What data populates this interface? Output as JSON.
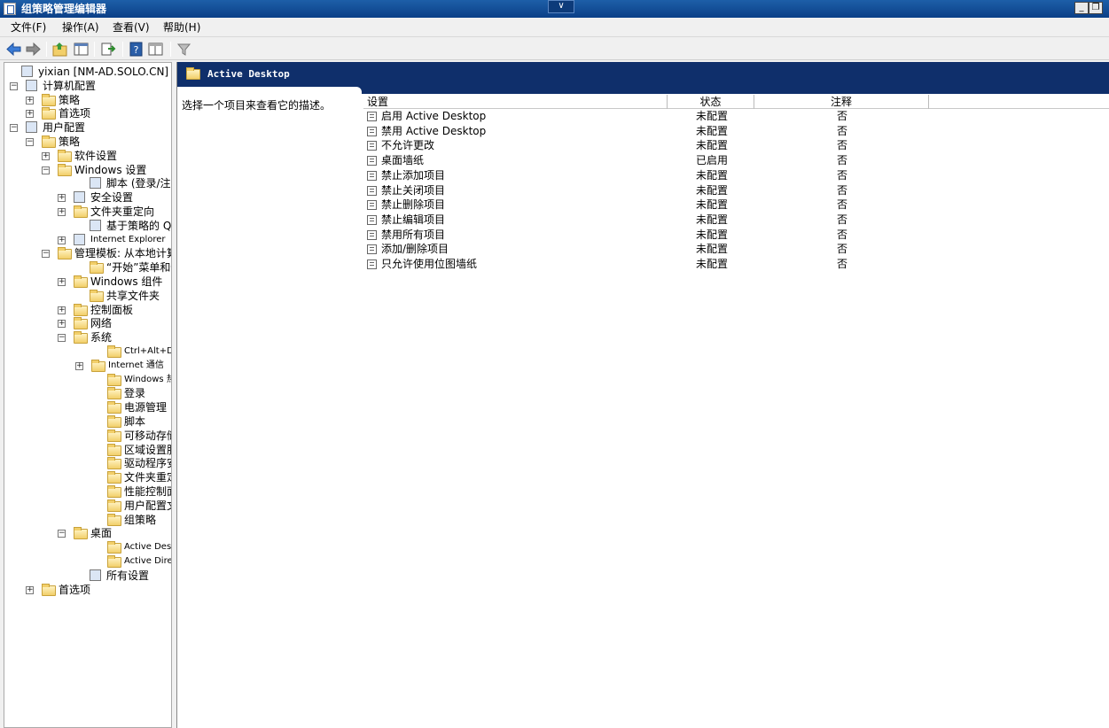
{
  "window": {
    "title": "组策略管理编辑器",
    "collapse_glyph": "∨",
    "minimize_glyph": "_",
    "maximize_glyph": "❐"
  },
  "menu": [
    "文件(F)",
    "操作(A)",
    "查看(V)",
    "帮助(H)"
  ],
  "tree": [
    {
      "label": "yixian [NM-AD.SOLO.CN] 策略",
      "icon": "policy-doc-icon",
      "expander": "",
      "small": false
    },
    {
      "label": "计算机配置",
      "icon": "computer-icon",
      "expander": "−",
      "small": false
    },
    {
      "label": "策略",
      "icon": "folder-icon",
      "expander": "+",
      "small": false
    },
    {
      "label": "首选项",
      "icon": "folder-icon",
      "expander": "+",
      "small": false
    },
    {
      "label": "用户配置",
      "icon": "user-icon",
      "expander": "−",
      "small": false
    },
    {
      "label": "策略",
      "icon": "folder-icon",
      "expander": "−",
      "small": false
    },
    {
      "label": "软件设置",
      "icon": "folder-icon",
      "expander": "+",
      "small": false
    },
    {
      "label": "Windows 设置",
      "icon": "folder-icon",
      "expander": "−",
      "small": false
    },
    {
      "label": "脚本 (登录/注销)",
      "icon": "script-icon",
      "expander": "",
      "small": false
    },
    {
      "label": "安全设置",
      "icon": "security-icon",
      "expander": "+",
      "small": false
    },
    {
      "label": "文件夹重定向",
      "icon": "folder-icon",
      "expander": "+",
      "small": false
    },
    {
      "label": "基于策略的 QoS",
      "icon": "qos-chart-icon",
      "expander": "",
      "small": false
    },
    {
      "label": "Internet Explorer",
      "icon": "ie-maintenance-icon",
      "expander": "+",
      "small": true
    },
    {
      "label": "管理模板: 从本地计算",
      "icon": "folder-icon",
      "expander": "−",
      "small": false
    },
    {
      "label": "“开始”菜单和任",
      "icon": "folder-icon",
      "expander": "",
      "small": false
    },
    {
      "label": "Windows 组件",
      "icon": "folder-icon",
      "expander": "+",
      "small": false
    },
    {
      "label": "共享文件夹",
      "icon": "folder-icon",
      "expander": "",
      "small": false
    },
    {
      "label": "控制面板",
      "icon": "folder-icon",
      "expander": "+",
      "small": false
    },
    {
      "label": "网络",
      "icon": "folder-icon",
      "expander": "+",
      "small": false
    },
    {
      "label": "系统",
      "icon": "folder-icon",
      "expander": "−",
      "small": false
    },
    {
      "label": "Ctrl+Alt+Del",
      "icon": "folder-icon",
      "expander": "",
      "small": true
    },
    {
      "label": "Internet 通信",
      "icon": "folder-icon",
      "expander": "+",
      "small": true
    },
    {
      "label": "Windows 热启",
      "icon": "folder-icon",
      "expander": "",
      "small": true
    },
    {
      "label": "登录",
      "icon": "folder-icon",
      "expander": "",
      "small": false
    },
    {
      "label": "电源管理",
      "icon": "folder-icon",
      "expander": "",
      "small": false
    },
    {
      "label": "脚本",
      "icon": "folder-icon",
      "expander": "",
      "small": false
    },
    {
      "label": "可移动存储访",
      "icon": "folder-icon",
      "expander": "",
      "small": false
    },
    {
      "label": "区域设置服务",
      "icon": "folder-icon",
      "expander": "",
      "small": false
    },
    {
      "label": "驱动程序安装",
      "icon": "folder-icon",
      "expander": "",
      "small": false
    },
    {
      "label": "文件夹重定向",
      "icon": "folder-icon",
      "expander": "",
      "small": false
    },
    {
      "label": "性能控制面板",
      "icon": "folder-icon",
      "expander": "",
      "small": false
    },
    {
      "label": "用户配置文件",
      "icon": "folder-icon",
      "expander": "",
      "small": false
    },
    {
      "label": "组策略",
      "icon": "folder-icon",
      "expander": "",
      "small": false
    },
    {
      "label": "桌面",
      "icon": "folder-icon",
      "expander": "−",
      "small": false
    },
    {
      "label": "Active Desktop",
      "icon": "folder-icon",
      "expander": "",
      "small": true
    },
    {
      "label": "Active Directory",
      "icon": "folder-icon",
      "expander": "",
      "small": true
    },
    {
      "label": "所有设置",
      "icon": "all-settings-icon",
      "expander": "",
      "small": false
    },
    {
      "label": "首选项",
      "icon": "folder-icon",
      "expander": "+",
      "small": false
    }
  ],
  "right": {
    "header_title": "Active Desktop",
    "description": "选择一个项目来查看它的描述。",
    "columns": [
      "设置",
      "状态",
      "注释"
    ],
    "rows": [
      [
        "启用 Active Desktop",
        "未配置",
        "否"
      ],
      [
        "禁用 Active Desktop",
        "未配置",
        "否"
      ],
      [
        "不允许更改",
        "未配置",
        "否"
      ],
      [
        "桌面墙纸",
        "已启用",
        "否"
      ],
      [
        "禁止添加项目",
        "未配置",
        "否"
      ],
      [
        "禁止关闭项目",
        "未配置",
        "否"
      ],
      [
        "禁止删除项目",
        "未配置",
        "否"
      ],
      [
        "禁止编辑项目",
        "未配置",
        "否"
      ],
      [
        "禁用所有项目",
        "未配置",
        "否"
      ],
      [
        "添加/删除项目",
        "未配置",
        "否"
      ],
      [
        "只允许使用位图墙纸",
        "未配置",
        "否"
      ]
    ]
  }
}
